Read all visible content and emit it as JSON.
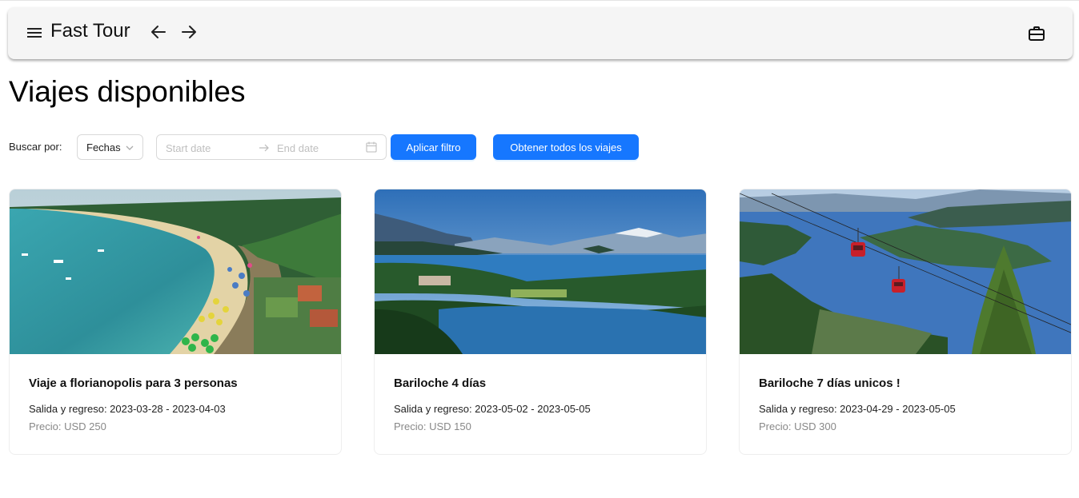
{
  "app": {
    "title": "Fast Tour"
  },
  "page": {
    "title": "Viajes disponibles"
  },
  "filter": {
    "label": "Buscar por:",
    "mode": "Fechas",
    "start_placeholder": "Start date",
    "end_placeholder": "End date",
    "apply_label": "Aplicar filtro",
    "all_label": "Obtener todos los viajes"
  },
  "trips": [
    {
      "title": "Viaje a florianopolis para 3 personas",
      "dates": "Salida y regreso: 2023-03-28 - 2023-04-03",
      "price": "Precio: USD 250"
    },
    {
      "title": "Bariloche 4 días",
      "dates": "Salida y regreso: 2023-05-02 - 2023-05-05",
      "price": "Precio: USD 150"
    },
    {
      "title": "Bariloche 7 días unicos !",
      "dates": "Salida y regreso: 2023-04-29 - 2023-05-05",
      "price": "Precio: USD 300"
    }
  ],
  "icons": {
    "menu": "menu-icon",
    "back": "arrow-left-icon",
    "forward": "arrow-right-icon",
    "bag": "briefcase-icon",
    "dropdown": "chevron-down-icon",
    "separator": "arrow-right-icon",
    "calendar": "calendar-icon"
  },
  "colors": {
    "primary": "#1677ff",
    "appbar": "#f5f5f5",
    "muted_text": "#888888"
  }
}
